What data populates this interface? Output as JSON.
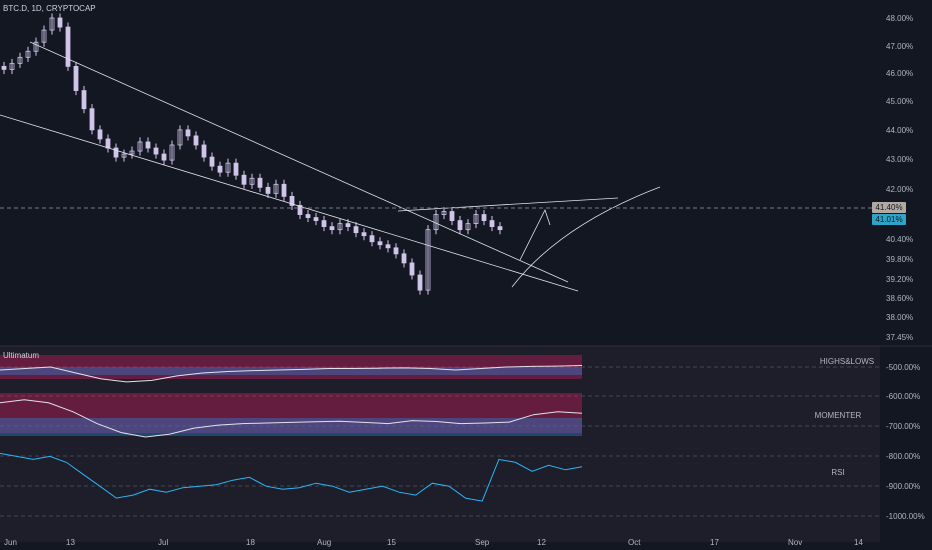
{
  "header": {
    "symbol": "BTC.D, 1D, CRYPTOCAP"
  },
  "indicator": {
    "name": "Ultimatum"
  },
  "panel_labels": {
    "highs_lows": "HIGHS&LOWS",
    "momenter": "MOMENTER",
    "rsi": "RSI"
  },
  "price_tags": {
    "last": "41.40%",
    "current": "41.01%"
  },
  "colors": {
    "background": "#131722",
    "candle": "#d1c4e9",
    "trendline": "#e0e3eb",
    "bear": "#e91e63",
    "bull": "#2196f3",
    "tag_last": "#b2a9a3",
    "tag_current": "#2ea4c9"
  },
  "chart_data": [
    {
      "type": "candlestick",
      "x_axis": {
        "ticks": [
          "Jun",
          "13",
          "Jul",
          "18",
          "Aug",
          "15",
          "Sep",
          "12",
          "Oct",
          "17",
          "Nov",
          "14"
        ]
      },
      "y_axis": {
        "unit": "%",
        "ticks": [
          "48.00%",
          "47.00%",
          "46.00%",
          "45.00%",
          "44.00%",
          "43.00%",
          "42.00%",
          "40.40%",
          "39.80%",
          "39.20%",
          "38.60%",
          "38.00%",
          "37.45%"
        ]
      },
      "close_series": [
        46.3,
        46.5,
        46.7,
        46.9,
        47.2,
        47.6,
        48.0,
        47.7,
        46.4,
        45.6,
        45.0,
        44.3,
        44.0,
        43.7,
        43.4,
        43.5,
        43.6,
        43.9,
        43.7,
        43.5,
        43.3,
        43.8,
        44.3,
        44.1,
        43.8,
        43.4,
        43.1,
        42.9,
        43.2,
        42.8,
        42.5,
        42.7,
        42.4,
        42.2,
        42.5,
        42.1,
        41.8,
        41.5,
        41.4,
        41.3,
        41.1,
        41.0,
        41.2,
        41.1,
        40.9,
        40.8,
        40.6,
        40.5,
        40.4,
        40.2,
        39.9,
        39.5,
        39.0,
        41.0,
        41.5,
        41.6,
        41.3,
        41.0,
        41.2,
        41.5,
        41.3,
        41.1,
        41.0
      ],
      "trendlines": "descending channel with breakout and rising wedge"
    },
    {
      "type": "line",
      "y_axis": {
        "ticks": [
          "-500.00%",
          "-600.00%",
          "-700.00%",
          "-800.00%",
          "-900.00%",
          "-1000.00%"
        ]
      },
      "series": [
        {
          "name": "HIGHS&LOWS",
          "values": [
            -510,
            -505,
            -500,
            -520,
            -540,
            -550,
            -545,
            -530,
            -520,
            -515,
            -512,
            -510,
            -508,
            -505,
            -505,
            -504,
            -503,
            -505,
            -510,
            -505,
            -500,
            -498,
            -497,
            -495
          ]
        },
        {
          "name": "MOMENTER",
          "values": [
            -620,
            -610,
            -620,
            -650,
            -690,
            -720,
            -735,
            -725,
            -705,
            -695,
            -690,
            -688,
            -686,
            -684,
            -682,
            -686,
            -690,
            -680,
            -683,
            -690,
            -688,
            -685,
            -660,
            -650,
            -655
          ]
        },
        {
          "name": "RSI",
          "values": [
            -790,
            -800,
            -810,
            -800,
            -820,
            -860,
            -900,
            -940,
            -930,
            -910,
            -920,
            -905,
            -900,
            -895,
            -880,
            -870,
            -900,
            -910,
            -905,
            -890,
            -900,
            -920,
            -910,
            -900,
            -920,
            -930,
            -890,
            -900,
            -940,
            -950,
            -810,
            -820,
            -850,
            -830,
            -845,
            -835
          ]
        }
      ]
    }
  ]
}
